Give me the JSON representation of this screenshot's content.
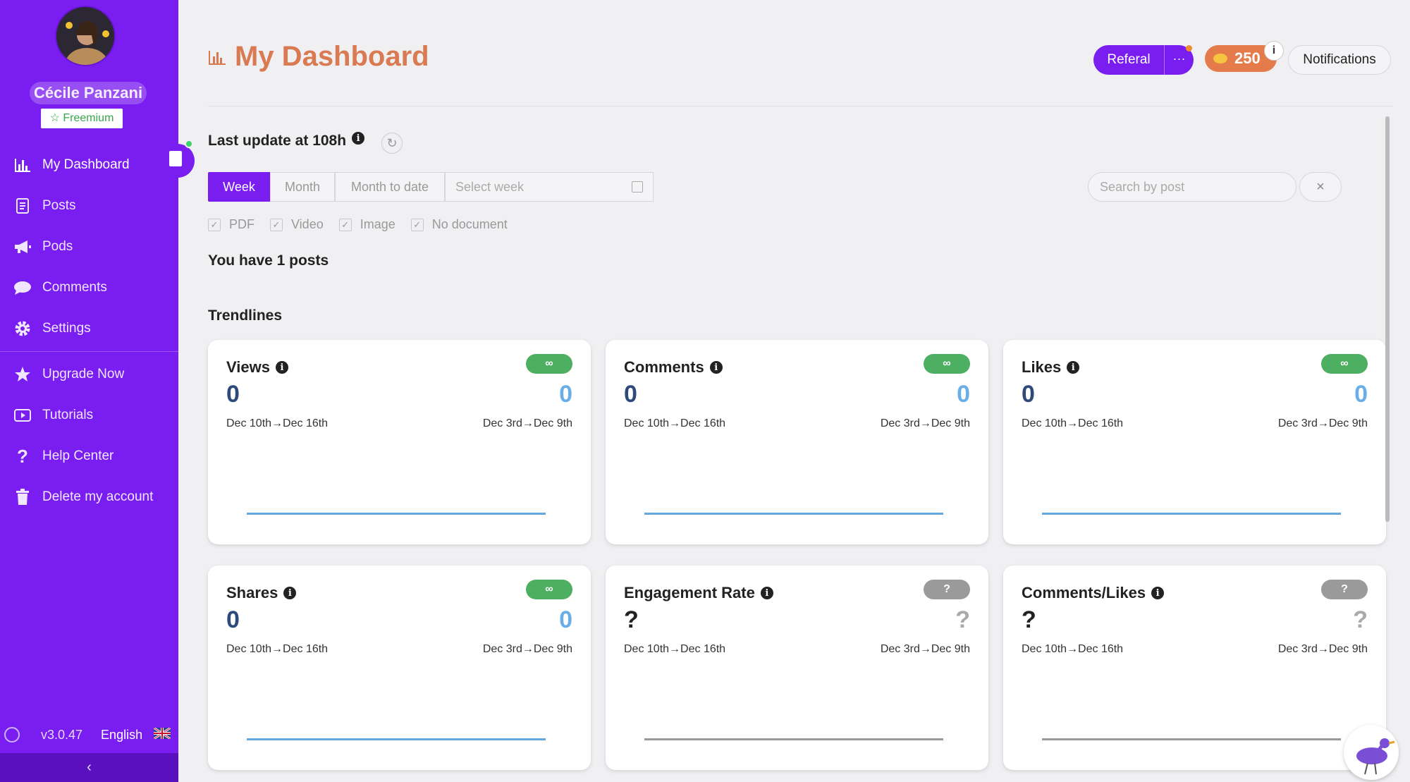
{
  "user": {
    "name": "Cécile Panzani",
    "plan": "Freemium"
  },
  "nav": {
    "items": [
      {
        "label": "My Dashboard",
        "icon": "bar-chart-icon"
      },
      {
        "label": "Posts",
        "icon": "document-icon"
      },
      {
        "label": "Pods",
        "icon": "megaphone-icon"
      },
      {
        "label": "Comments",
        "icon": "speech-bubble-icon"
      },
      {
        "label": "Settings",
        "icon": "gear-icon"
      },
      {
        "label": "Upgrade Now",
        "icon": "star-icon"
      },
      {
        "label": "Tutorials",
        "icon": "play-icon"
      },
      {
        "label": "Help Center",
        "icon": "question-icon"
      },
      {
        "label": "Delete my account",
        "icon": "trash-icon"
      }
    ]
  },
  "footer": {
    "version": "v3.0.47",
    "language": "English",
    "collapse": "‹"
  },
  "header": {
    "title": "My Dashboard",
    "referal": "Referal",
    "more": "···",
    "credits": "250",
    "info": "i",
    "notifications": "Notifications"
  },
  "status": {
    "last_update": "Last update at 108h",
    "info": "i"
  },
  "period": {
    "tabs": [
      "Week",
      "Month",
      "Month to date"
    ],
    "active": "Week",
    "week_placeholder": "Select week"
  },
  "search": {
    "placeholder": "Search by post",
    "clear": "×"
  },
  "filters": [
    "PDF",
    "Video",
    "Image",
    "No document"
  ],
  "posts_count": "You have 1 posts",
  "trendlines": {
    "title": "Trendlines",
    "cards": [
      {
        "title": "Views",
        "badge": "∞",
        "current": "0",
        "previous": "0",
        "current_range": "Dec 10th→Dec 16th",
        "previous_range": "Dec 3rd→Dec 9th",
        "series_color": "#62a7de"
      },
      {
        "title": "Comments",
        "badge": "∞",
        "current": "0",
        "previous": "0",
        "current_range": "Dec 10th→Dec 16th",
        "previous_range": "Dec 3rd→Dec 9th",
        "series_color": "#62a7de"
      },
      {
        "title": "Likes",
        "badge": "∞",
        "current": "0",
        "previous": "0",
        "current_range": "Dec 10th→Dec 16th",
        "previous_range": "Dec 3rd→Dec 9th",
        "series_color": "#62a7de"
      },
      {
        "title": "Shares",
        "badge": "∞",
        "current": "0",
        "previous": "0",
        "current_range": "Dec 10th→Dec 16th",
        "previous_range": "Dec 3rd→Dec 9th",
        "series_color": "#62a7de"
      },
      {
        "title": "Engagement Rate",
        "badge": "?",
        "current": "?",
        "previous": "?",
        "current_range": "Dec 10th→Dec 16th",
        "previous_range": "Dec 3rd→Dec 9th",
        "series_color": "#999999"
      },
      {
        "title": "Comments/Likes",
        "badge": "?",
        "current": "?",
        "previous": "?",
        "current_range": "Dec 10th→Dec 16th",
        "previous_range": "Dec 3rd→Dec 9th",
        "series_color": "#999999"
      }
    ]
  },
  "colors": {
    "sidebar": "#7a1df0",
    "title": "#d97a52",
    "badge_green": "#4caf62",
    "badge_grey": "#9a9a9a"
  }
}
